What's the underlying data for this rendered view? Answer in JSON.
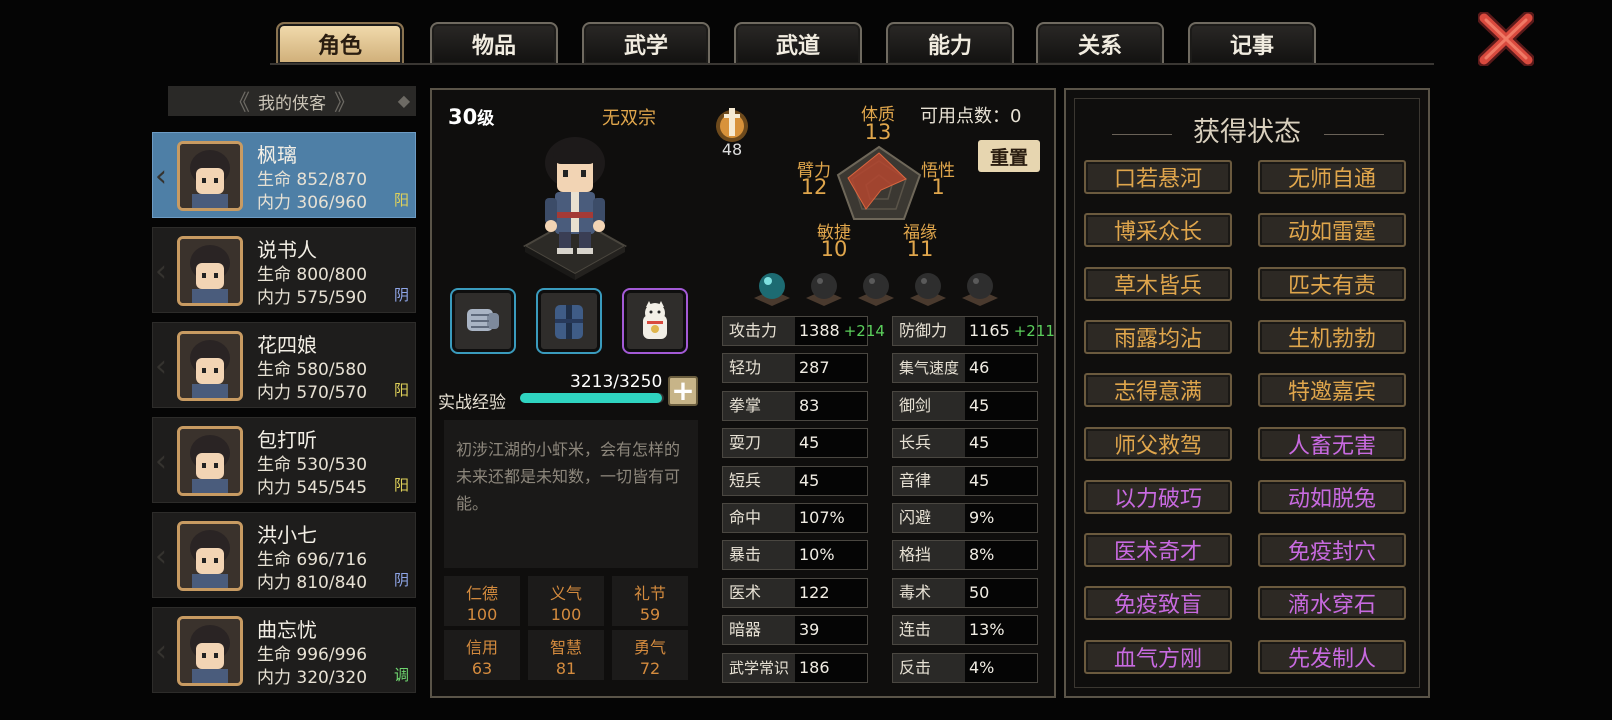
{
  "tabs": [
    {
      "label": "角色",
      "active": true
    },
    {
      "label": "物品",
      "active": false
    },
    {
      "label": "武学",
      "active": false
    },
    {
      "label": "武道",
      "active": false
    },
    {
      "label": "能力",
      "active": false
    },
    {
      "label": "关系",
      "active": false
    },
    {
      "label": "记事",
      "active": false
    }
  ],
  "roster": {
    "header": "我的侠客",
    "heroes": [
      {
        "name": "枫璃",
        "hp": "生命 852/870",
        "mp": "内力 306/960",
        "tag": "阳",
        "selected": true
      },
      {
        "name": "说书人",
        "hp": "生命 800/800",
        "mp": "内力 575/590",
        "tag": "阴",
        "selected": false
      },
      {
        "name": "花四娘",
        "hp": "生命 580/580",
        "mp": "内力 570/570",
        "tag": "阳",
        "selected": false
      },
      {
        "name": "包打听",
        "hp": "生命 530/530",
        "mp": "内力 545/545",
        "tag": "阳",
        "selected": false
      },
      {
        "name": "洪小七",
        "hp": "生命 696/716",
        "mp": "内力 810/840",
        "tag": "阴",
        "selected": false
      },
      {
        "name": "曲忘忧",
        "hp": "生命 996/996",
        "mp": "内力 320/320",
        "tag": "调",
        "selected": false
      }
    ]
  },
  "character": {
    "level_num": "30",
    "level_unit": "级",
    "sect": "无双宗",
    "trophy_value": "48",
    "points_label": "可用点数：0",
    "reset_label": "重置",
    "attributes": {
      "constitution": {
        "label": "体质",
        "value": "13"
      },
      "arm": {
        "label": "臂力",
        "value": "12"
      },
      "insight": {
        "label": "悟性",
        "value": "1"
      },
      "agility": {
        "label": "敏捷",
        "value": "10"
      },
      "fortune": {
        "label": "福缘",
        "value": "11"
      }
    },
    "exp_label": "实战经验",
    "exp_value": "3213/3250",
    "exp_fraction": 0.988,
    "description": "初涉江湖的小虾米，会有怎样的未来还都是未知数，一切皆有可能。",
    "virtues": [
      {
        "label": "仁德",
        "value": "100"
      },
      {
        "label": "义气",
        "value": "100"
      },
      {
        "label": "礼节",
        "value": "59"
      },
      {
        "label": "信用",
        "value": "63"
      },
      {
        "label": "智慧",
        "value": "81"
      },
      {
        "label": "勇气",
        "value": "72"
      }
    ],
    "stats_left": [
      {
        "label": "攻击力",
        "value": "1388",
        "bonus": "+214"
      },
      {
        "label": "轻功",
        "value": "287",
        "bonus": ""
      },
      {
        "label": "拳掌",
        "value": "83",
        "bonus": ""
      },
      {
        "label": "耍刀",
        "value": "45",
        "bonus": ""
      },
      {
        "label": "短兵",
        "value": "45",
        "bonus": ""
      },
      {
        "label": "命中",
        "value": "107%",
        "bonus": ""
      },
      {
        "label": "暴击",
        "value": "10%",
        "bonus": ""
      },
      {
        "label": "医术",
        "value": "122",
        "bonus": ""
      },
      {
        "label": "暗器",
        "value": "39",
        "bonus": ""
      },
      {
        "label": "武学常识",
        "value": "186",
        "bonus": ""
      }
    ],
    "stats_right": [
      {
        "label": "防御力",
        "value": "1165",
        "bonus": "+211"
      },
      {
        "label": "集气速度",
        "value": "46",
        "bonus": ""
      },
      {
        "label": "御剑",
        "value": "45",
        "bonus": ""
      },
      {
        "label": "长兵",
        "value": "45",
        "bonus": ""
      },
      {
        "label": "音律",
        "value": "45",
        "bonus": ""
      },
      {
        "label": "闪避",
        "value": "9%",
        "bonus": ""
      },
      {
        "label": "格挡",
        "value": "8%",
        "bonus": ""
      },
      {
        "label": "毒术",
        "value": "50",
        "bonus": ""
      },
      {
        "label": "连击",
        "value": "13%",
        "bonus": ""
      },
      {
        "label": "反击",
        "value": "4%",
        "bonus": ""
      }
    ]
  },
  "status": {
    "title": "获得状态",
    "items": [
      {
        "label": "口若悬河",
        "color": "#e0a64c"
      },
      {
        "label": "无师自通",
        "color": "#e0a64c"
      },
      {
        "label": "博采众长",
        "color": "#e0a64c"
      },
      {
        "label": "动如雷霆",
        "color": "#e0a64c"
      },
      {
        "label": "草木皆兵",
        "color": "#e0a64c"
      },
      {
        "label": "匹夫有责",
        "color": "#e0a64c"
      },
      {
        "label": "雨露均沾",
        "color": "#e0a64c"
      },
      {
        "label": "生机勃勃",
        "color": "#e0a64c"
      },
      {
        "label": "志得意满",
        "color": "#e0a64c"
      },
      {
        "label": "特邀嘉宾",
        "color": "#e0a64c"
      },
      {
        "label": "师父救驾",
        "color": "#e0a64c"
      },
      {
        "label": "人畜无害",
        "color": "#c86ae0"
      },
      {
        "label": "以力破巧",
        "color": "#c86ae0"
      },
      {
        "label": "动如脱兔",
        "color": "#c86ae0"
      },
      {
        "label": "医术奇才",
        "color": "#c86ae0"
      },
      {
        "label": "免疫封穴",
        "color": "#c86ae0"
      },
      {
        "label": "免疫致盲",
        "color": "#c86ae0"
      },
      {
        "label": "滴水穿石",
        "color": "#c86ae0"
      },
      {
        "label": "血气方刚",
        "color": "#c86ae0"
      },
      {
        "label": "先发制人",
        "color": "#c86ae0"
      }
    ]
  },
  "icons": {
    "close": "close-x-icon",
    "trophy": "trophy-icon",
    "equip": [
      "gauntlet-icon",
      "armor-icon",
      "lucky-cat-icon"
    ]
  }
}
